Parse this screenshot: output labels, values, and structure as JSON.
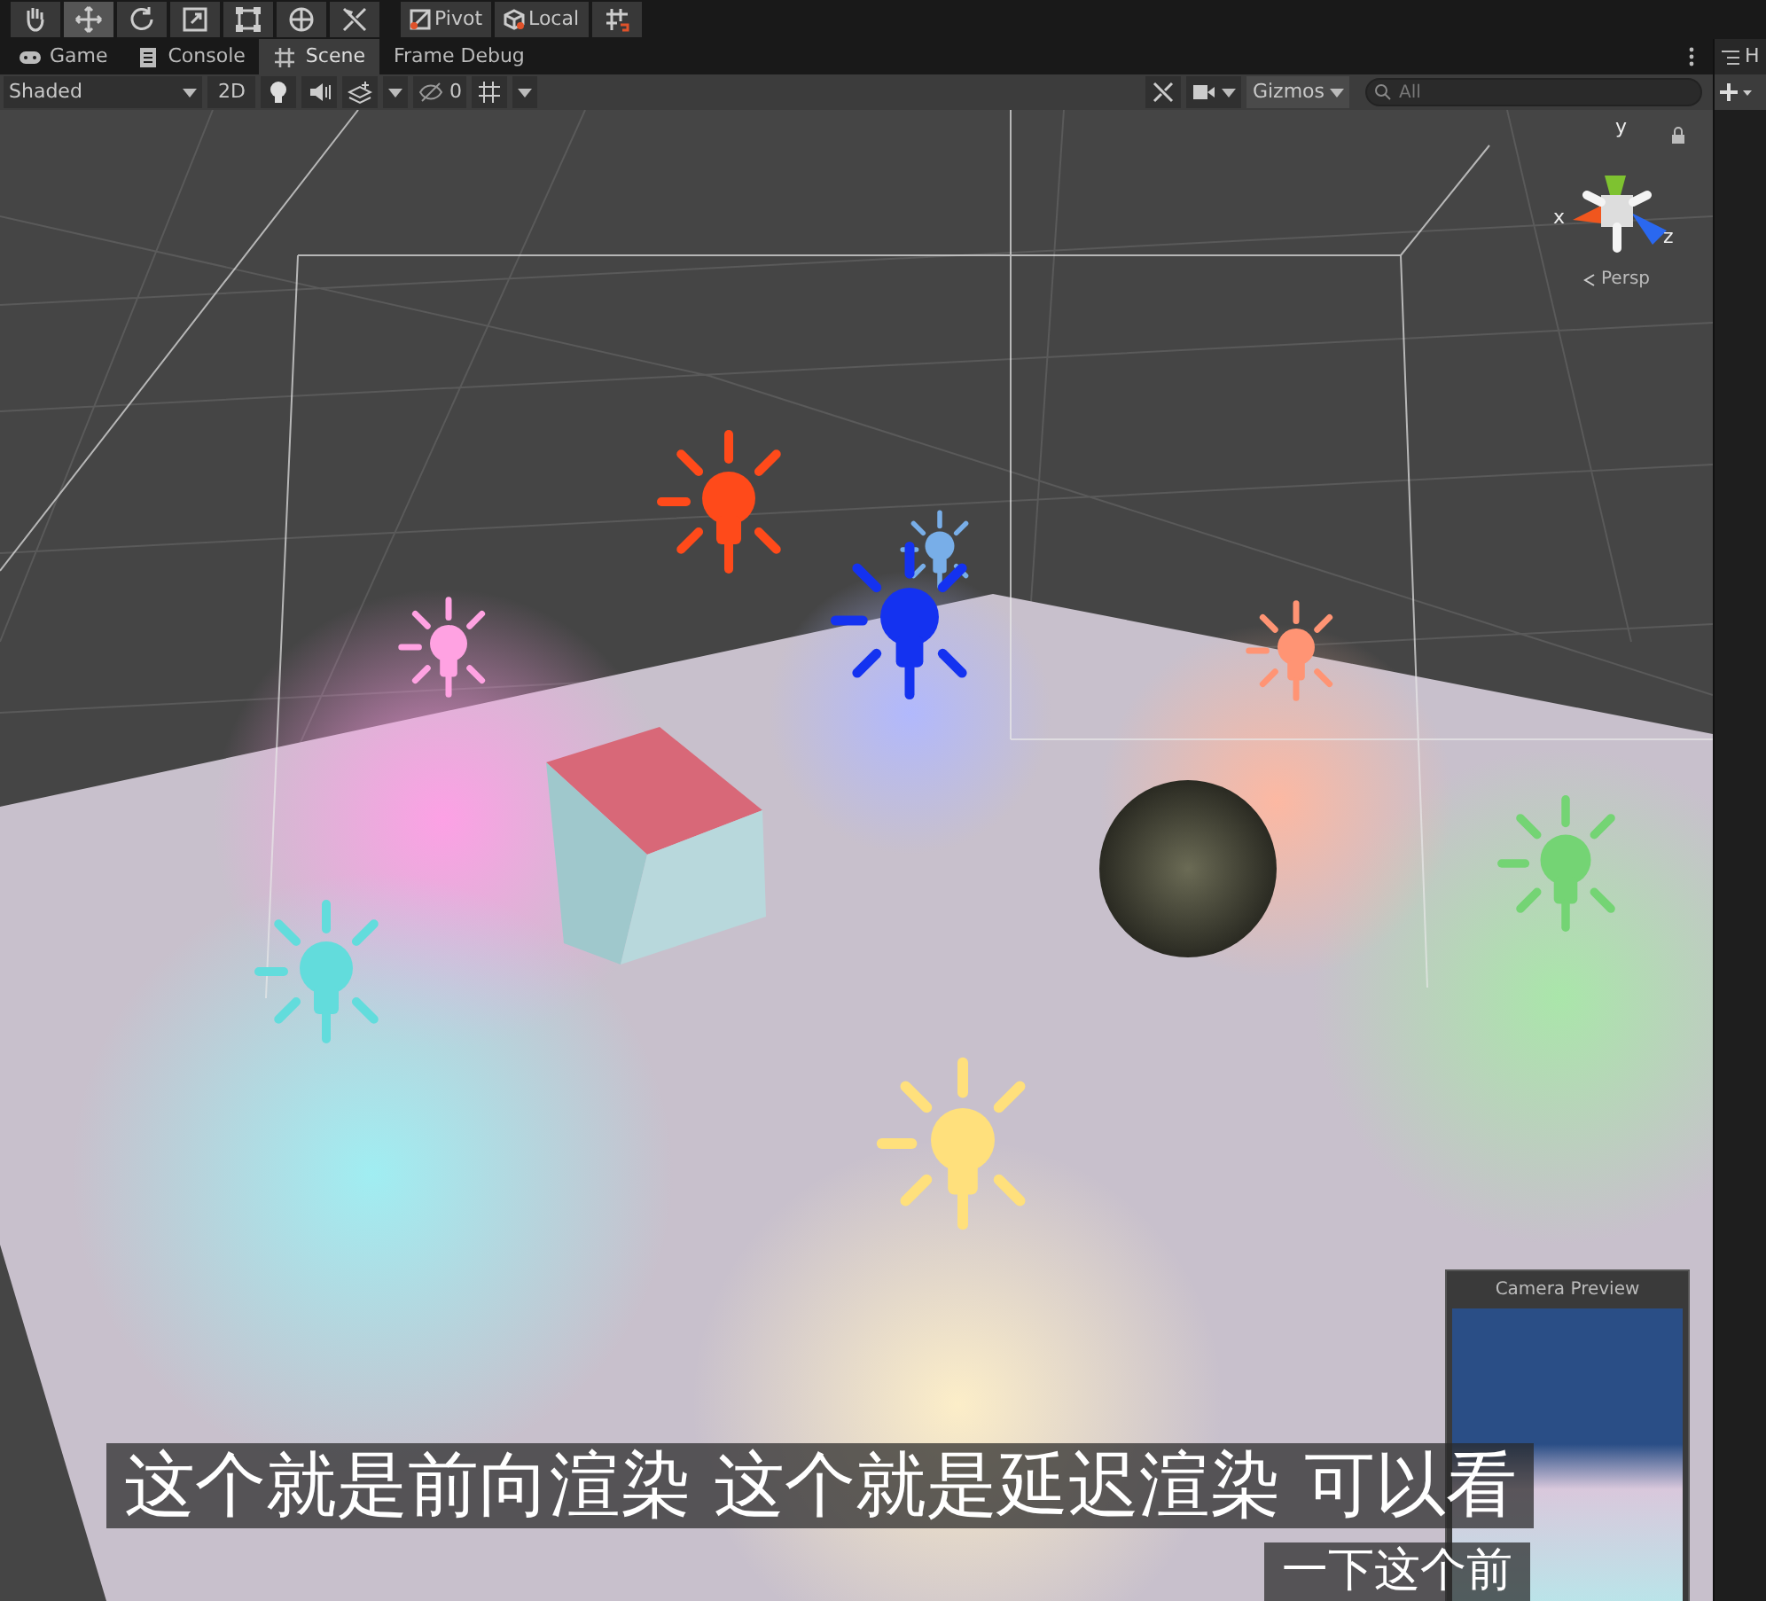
{
  "toolbar": {
    "tools": [
      {
        "kind": "hand",
        "selected": false
      },
      {
        "kind": "move",
        "selected": true
      },
      {
        "kind": "rotate",
        "selected": false
      },
      {
        "kind": "scale",
        "selected": false
      },
      {
        "kind": "rect",
        "selected": false
      },
      {
        "kind": "transform",
        "selected": false
      },
      {
        "kind": "custom",
        "selected": false
      }
    ],
    "pivot": "Pivot",
    "local": "Local"
  },
  "tabs": [
    {
      "kind": "game",
      "label": "Game",
      "selected": false
    },
    {
      "kind": "console",
      "label": "Console",
      "selected": false
    },
    {
      "kind": "scene",
      "label": "Scene",
      "selected": true
    },
    {
      "kind": "plain",
      "label": "Frame Debug",
      "selected": false
    }
  ],
  "scene_toolbar": {
    "shading": "Shaded",
    "mode_2d": "2D",
    "hidden_count": "0",
    "gizmos": "Gizmos",
    "search": {
      "placeholder": "All"
    }
  },
  "hierarchy_panel": {
    "title": "H"
  },
  "scene": {
    "gizmo": {
      "y": "y",
      "x": "x",
      "z": "z",
      "projection": "Persp"
    },
    "lights": [
      {
        "color": "#ff4a1a"
      },
      {
        "color": "#78aee8"
      },
      {
        "color": "#1432f0"
      },
      {
        "color": "#ffa2e2"
      },
      {
        "color": "#ff9474"
      },
      {
        "color": "#74d474"
      },
      {
        "color": "#62dcdc"
      },
      {
        "color": "#ffe07c"
      }
    ],
    "camera_preview": {
      "title": "Camera Preview"
    }
  },
  "subtitles": [
    "这个就是前向渲染 这个就是延迟渲染 可以看",
    "一下这个前"
  ]
}
